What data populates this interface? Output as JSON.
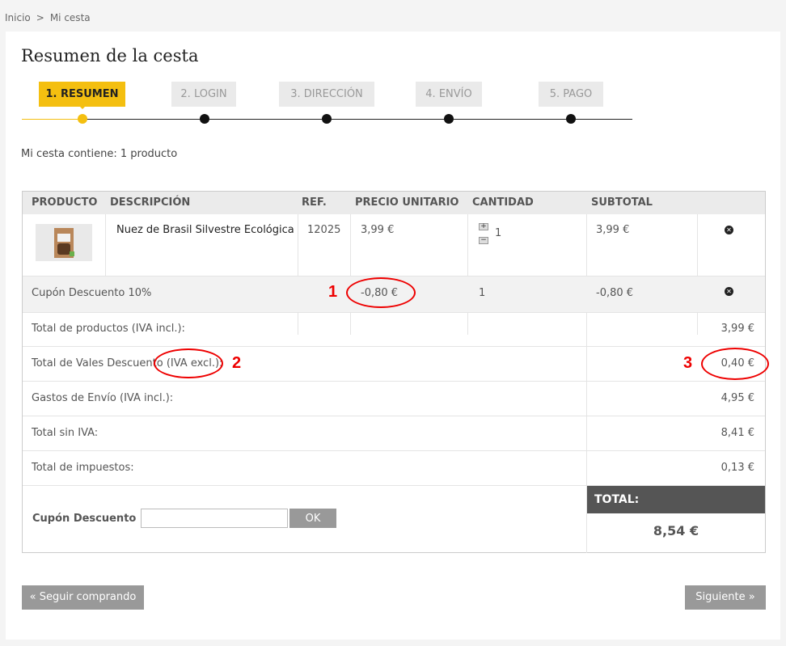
{
  "breadcrumb": {
    "home": "Inicio",
    "separator": ">",
    "current": "Mi cesta"
  },
  "page_title": "Resumen de la cesta",
  "steps": [
    {
      "label": "1. RESUMEN",
      "active": true
    },
    {
      "label": "2. LOGIN",
      "active": false
    },
    {
      "label": "3. DIRECCIÓN",
      "active": false
    },
    {
      "label": "4. ENVÍO",
      "active": false
    },
    {
      "label": "5. PAGO",
      "active": false
    }
  ],
  "summary_text": "Mi cesta contiene: 1 producto",
  "table": {
    "headers": [
      "PRODUCTO",
      "DESCRIPCIÓN",
      "REF.",
      "PRECIO UNITARIO",
      "CANTIDAD",
      "SUBTOTAL"
    ],
    "product": {
      "description": "Nuez de Brasil Silvestre Ecológica",
      "ref": "12025",
      "unit_price": "3,99 €",
      "quantity": "1",
      "subtotal": "3,99 €",
      "plus_label": "+",
      "minus_label": "−",
      "delete_label": "✕"
    },
    "discount": {
      "label": "Cupón Descuento 10%",
      "unit_price": "-0,80 €",
      "quantity": "1",
      "subtotal": "-0,80 €",
      "delete_label": "✕"
    },
    "totals": [
      {
        "label": "Total de productos (IVA incl.):",
        "value": "3,99 €"
      },
      {
        "label": "Total de Vales Descuento (IVA excl.):",
        "value": "0,40 €"
      },
      {
        "label": "Gastos de Envío (IVA incl.):",
        "value": "4,95 €"
      },
      {
        "label": "Total sin IVA:",
        "value": "8,41 €"
      },
      {
        "label": "Total de impuestos:",
        "value": "0,13 €"
      }
    ],
    "coupon": {
      "label": "Cupón Descuento",
      "value": "",
      "button": "OK"
    },
    "total": {
      "label": "TOTAL:",
      "value": "8,54 €"
    }
  },
  "buttons": {
    "back": "« Seguir comprando",
    "next": "Siguiente »"
  },
  "annotations": [
    "1",
    "2",
    "3"
  ],
  "colors": {
    "accent": "#f4bf10",
    "annotation": "#e00000",
    "button": "#999999",
    "total_header": "#555555"
  }
}
